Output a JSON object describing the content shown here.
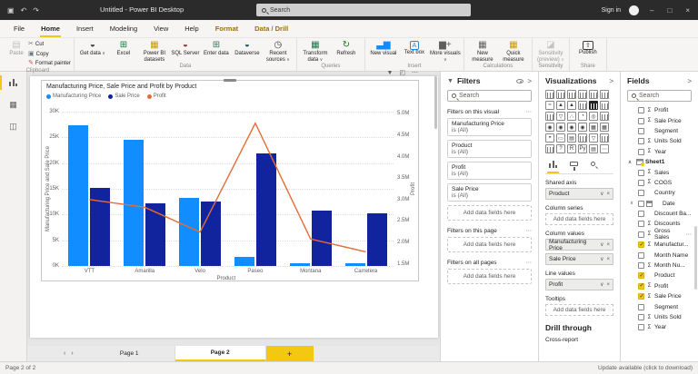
{
  "titlebar": {
    "title": "Untitled - Power BI Desktop",
    "search_placeholder": "Search",
    "sign_in_label": "Sign in",
    "minimize": "–",
    "maximize": "□",
    "close": "×"
  },
  "icons": {
    "save": "▣",
    "undo": "↶",
    "redo": "↷",
    "chevron_down": "∨",
    "remove": "×",
    "more": "⋯",
    "collapse": ">",
    "filter": "▼",
    "focus": "◰",
    "nav_prev": "‹",
    "nav_next": "›"
  },
  "menubar": {
    "tabs": [
      {
        "label": "File"
      },
      {
        "label": "Home",
        "active": true
      },
      {
        "label": "Insert"
      },
      {
        "label": "Modeling"
      },
      {
        "label": "View"
      },
      {
        "label": "Help"
      },
      {
        "label": "Format",
        "contextual": true
      },
      {
        "label": "Data / Drill",
        "contextual": true
      }
    ]
  },
  "ribbon": {
    "groups": [
      {
        "label": "Clipboard",
        "buttons": [
          {
            "label": "Paste",
            "icon": "paste-icon",
            "glyph": "▤",
            "color": "#8a8886",
            "big": true,
            "narrow": true,
            "disabled": true
          },
          {
            "label": "Cut",
            "icon": "cut-icon",
            "glyph": "✂",
            "color": "#69797e",
            "stack": true
          },
          {
            "label": "Copy",
            "icon": "copy-icon",
            "glyph": "▣",
            "color": "#69797e",
            "stack": true
          },
          {
            "label": "Format painter",
            "icon": "format-painter-icon",
            "glyph": "✎",
            "color": "#c0504d",
            "stack": true
          }
        ]
      },
      {
        "label": "Data",
        "buttons": [
          {
            "label": "Get data",
            "icon": "get-data-icon",
            "glyph": "◒",
            "color": "#3b3a39",
            "big": true,
            "dropdown": true
          },
          {
            "label": "Excel",
            "icon": "excel-icon",
            "glyph": "⊞",
            "color": "#107c41",
            "big": true
          },
          {
            "label": "Power BI datasets",
            "icon": "power-bi-datasets-icon",
            "glyph": "▦",
            "color": "#c99b00",
            "big": true
          },
          {
            "label": "SQL Server",
            "icon": "sql-server-icon",
            "glyph": "◒",
            "color": "#a4262c",
            "big": true
          },
          {
            "label": "Enter data",
            "icon": "enter-data-icon",
            "glyph": "⊞",
            "color": "#3b7a57",
            "big": true
          },
          {
            "label": "Dataverse",
            "icon": "dataverse-icon",
            "glyph": "◒",
            "color": "#0b556a",
            "big": true
          },
          {
            "label": "Recent sources",
            "icon": "recent-sources-icon",
            "glyph": "◷",
            "color": "#3b3a39",
            "big": true,
            "dropdown": true
          }
        ]
      },
      {
        "label": "Queries",
        "buttons": [
          {
            "label": "Transform data",
            "icon": "transform-data-icon",
            "glyph": "▦",
            "color": "#217346",
            "big": true,
            "dropdown": true
          },
          {
            "label": "Refresh",
            "icon": "refresh-icon",
            "glyph": "↻",
            "color": "#107c10",
            "big": true
          }
        ]
      },
      {
        "label": "Insert",
        "buttons": [
          {
            "label": "New visual",
            "icon": "new-visual-icon",
            "glyph": "▃▆",
            "color": "#118DFF",
            "big": true
          },
          {
            "label": "Text box",
            "icon": "text-box-icon",
            "glyph": "A",
            "color": "#2b88d8",
            "big": true,
            "boxed": true
          },
          {
            "label": "More visuals",
            "icon": "more-visuals-icon",
            "glyph": "▆+",
            "color": "#605e5c",
            "big": true,
            "dropdown": true
          }
        ]
      },
      {
        "label": "Calculations",
        "buttons": [
          {
            "label": "New measure",
            "icon": "new-measure-icon",
            "glyph": "▦",
            "color": "#605e5c",
            "big": true
          },
          {
            "label": "Quick measure",
            "icon": "quick-measure-icon",
            "glyph": "▦",
            "color": "#c99b00",
            "big": true
          }
        ]
      },
      {
        "label": "Sensitivity",
        "buttons": [
          {
            "label": "Sensitivity (preview)",
            "icon": "sensitivity-icon",
            "glyph": "◪",
            "color": "#8a8886",
            "big": true,
            "disabled": true,
            "dropdown": true
          }
        ]
      },
      {
        "label": "Share",
        "buttons": [
          {
            "label": "Publish",
            "icon": "publish-icon",
            "glyph": "⇧",
            "color": "#3b3a39",
            "big": true,
            "boxed": true
          }
        ]
      }
    ]
  },
  "view_sidebar": {
    "items": [
      {
        "name": "report-view",
        "active": true
      },
      {
        "name": "data-view",
        "glyph": "▦"
      },
      {
        "name": "model-view",
        "glyph": "◫"
      }
    ]
  },
  "visual_toolbar": {
    "icons": [
      "filter-icon",
      "focus-mode-icon",
      "more-options-icon"
    ]
  },
  "chart_data": {
    "type": "line and clustered column combo",
    "title": "Manufacturing Price, Sale Price and Profit by Product",
    "categories": [
      "VTT",
      "Amarilla",
      "Velo",
      "Paseo",
      "Montana",
      "Carretera"
    ],
    "series": [
      {
        "name": "Manufacturing Price",
        "type": "column",
        "axis": "left",
        "color": "#118DFF",
        "values": [
          27.3,
          24.6,
          13.2,
          1.8,
          0.6,
          0.5
        ]
      },
      {
        "name": "Sale Price",
        "type": "column",
        "axis": "left",
        "color": "#12239E",
        "values": [
          15.1,
          12.1,
          12.5,
          21.9,
          10.8,
          10.2
        ]
      },
      {
        "name": "Profit",
        "type": "line",
        "axis": "right",
        "color": "#E66C37",
        "values": [
          3.0,
          2.82,
          2.24,
          4.78,
          2.08,
          1.78
        ]
      }
    ],
    "left_axis": {
      "title": "Manufacturing Price and Sale Price",
      "unit": "K",
      "min": 0,
      "max": 30,
      "ticks": [
        {
          "label": "0K",
          "v": 0
        },
        {
          "label": "5K",
          "v": 5
        },
        {
          "label": "10K",
          "v": 10
        },
        {
          "label": "15K",
          "v": 15
        },
        {
          "label": "20K",
          "v": 20
        },
        {
          "label": "25K",
          "v": 25
        },
        {
          "label": "30K",
          "v": 30
        }
      ]
    },
    "right_axis": {
      "title": "Profit",
      "unit": "M",
      "min": 1.45,
      "max": 5.05,
      "ticks": [
        {
          "label": "1.5M",
          "v": 1.5
        },
        {
          "label": "2.0M",
          "v": 2.0
        },
        {
          "label": "2.5M",
          "v": 2.5
        },
        {
          "label": "3.0M",
          "v": 3.0
        },
        {
          "label": "3.5M",
          "v": 3.5
        },
        {
          "label": "4.0M",
          "v": 4.0
        },
        {
          "label": "4.5M",
          "v": 4.5
        },
        {
          "label": "5.0M",
          "v": 5.0
        }
      ]
    },
    "x_axis": {
      "title": "Product"
    },
    "legend_position": "top-left",
    "grid": true
  },
  "filters_pane": {
    "title": "Filters",
    "search_placeholder": "Search",
    "sections": [
      {
        "label": "Filters on this visual",
        "cards": [
          {
            "name": "Manufacturing Price",
            "condition": "is (All)"
          },
          {
            "name": "Product",
            "condition": "is (All)"
          },
          {
            "name": "Profit",
            "condition": "is (All)"
          },
          {
            "name": "Sale Price",
            "condition": "is (All)"
          }
        ],
        "add_placeholder": "Add data fields here"
      },
      {
        "label": "Filters on this page",
        "cards": [],
        "add_placeholder": "Add data fields here"
      },
      {
        "label": "Filters on all pages",
        "cards": [],
        "add_placeholder": "Add data fields here"
      }
    ]
  },
  "viz_pane": {
    "title": "Visualizations",
    "icons": [
      {
        "n": "stacked-bar-chart-icon"
      },
      {
        "n": "stacked-column-chart-icon"
      },
      {
        "n": "clustered-bar-chart-icon"
      },
      {
        "n": "clustered-column-chart-icon"
      },
      {
        "n": "100-stacked-bar-chart-icon"
      },
      {
        "n": "100-stacked-column-chart-icon"
      },
      {
        "n": "line-chart-icon",
        "g": "≈"
      },
      {
        "n": "area-chart-icon",
        "g": "▲"
      },
      {
        "n": "stacked-area-chart-icon",
        "g": "▲"
      },
      {
        "n": "line-and-stacked-column-chart-icon"
      },
      {
        "n": "line-and-clustered-column-chart-icon",
        "selected": true
      },
      {
        "n": "ribbon-chart-icon"
      },
      {
        "n": "waterfall-chart-icon"
      },
      {
        "n": "funnel-chart-icon",
        "g": "▽"
      },
      {
        "n": "scatter-chart-icon",
        "g": "∴"
      },
      {
        "n": "pie-chart-icon",
        "g": "◔"
      },
      {
        "n": "donut-chart-icon",
        "g": "◎"
      },
      {
        "n": "treemap-icon"
      },
      {
        "n": "map-icon",
        "g": "◉"
      },
      {
        "n": "filled-map-icon",
        "g": "◉"
      },
      {
        "n": "shape-map-icon",
        "g": "◉"
      },
      {
        "n": "azure-map-icon",
        "g": "◉"
      },
      {
        "n": "table-icon",
        "g": "▦"
      },
      {
        "n": "matrix-icon",
        "g": "▦"
      },
      {
        "n": "gauge-icon",
        "g": "◓"
      },
      {
        "n": "card-icon",
        "g": "▭"
      },
      {
        "n": "multi-row-card-icon",
        "g": "▤"
      },
      {
        "n": "kpi-icon"
      },
      {
        "n": "slicer-icon",
        "g": "▽"
      },
      {
        "n": "key-influencers-icon"
      },
      {
        "n": "decomposition-tree-icon"
      },
      {
        "n": "qa-visual-icon",
        "g": "?"
      },
      {
        "n": "r-script-visual-icon",
        "g": "R"
      },
      {
        "n": "python-visual-icon",
        "g": "Py"
      },
      {
        "n": "paginated-report-icon",
        "g": "▤"
      },
      {
        "n": "more-visuals-ellipsis-icon",
        "g": "⋯"
      }
    ],
    "tabs": [
      {
        "name": "fields-tab",
        "active": true
      },
      {
        "name": "format-tab"
      },
      {
        "name": "analytics-tab"
      }
    ],
    "wells": [
      {
        "label": "Shared axis",
        "pills": [
          "Product"
        ]
      },
      {
        "label": "Column series",
        "pills": [],
        "placeholder": "Add data fields here"
      },
      {
        "label": "Column values",
        "pills": [
          "Manufacturing Price",
          "Sale Price"
        ]
      },
      {
        "label": "Line values",
        "pills": [
          "Profit"
        ]
      },
      {
        "label": "Tooltips",
        "pills": [],
        "placeholder": "Add data fields here"
      }
    ],
    "drill_through_label": "Drill through",
    "cross_report_label": "Cross-report"
  },
  "fields_pane": {
    "title": "Fields",
    "search_placeholder": "Search",
    "items": [
      {
        "name": "Profit",
        "sigma": true
      },
      {
        "name": "Sale Price",
        "sigma": true
      },
      {
        "name": "Segment"
      },
      {
        "name": "Units Sold",
        "sigma": true
      },
      {
        "name": "Year",
        "sigma": true
      },
      {
        "name": "Sheet1",
        "table": true,
        "expander": "∧"
      },
      {
        "name": "Sales",
        "sigma": true
      },
      {
        "name": "COGS",
        "sigma": true
      },
      {
        "name": "Country"
      },
      {
        "name": "Date",
        "date": true,
        "expander": "∨"
      },
      {
        "name": "Discount Ba..."
      },
      {
        "name": "Discounts",
        "sigma": true
      },
      {
        "name": "Gross Sales",
        "sigma": true,
        "more": true
      },
      {
        "name": "Manufactur...",
        "sigma": true,
        "checked": true
      },
      {
        "name": "Month Name"
      },
      {
        "name": "Month Nu...",
        "sigma": true
      },
      {
        "name": "Product",
        "checked": true
      },
      {
        "name": "Profit",
        "sigma": true,
        "checked": true
      },
      {
        "name": "Sale Price",
        "sigma": true,
        "checked": true
      },
      {
        "name": "Segment"
      },
      {
        "name": "Units Sold",
        "sigma": true
      },
      {
        "name": "Year",
        "sigma": true
      }
    ]
  },
  "pages": {
    "tabs": [
      {
        "label": "Page 1"
      },
      {
        "label": "Page 2",
        "active": true
      }
    ],
    "add_label": "+"
  },
  "statusbar": {
    "left": "Page 2 of 2",
    "right": "Update available (click to download)"
  },
  "theme": {
    "accent_yellow": "#F2C811",
    "titlebar_bg": "#2B2B2B",
    "bar_blue": "#118DFF",
    "bar_navy": "#12239E",
    "line_orange": "#E66C37"
  }
}
